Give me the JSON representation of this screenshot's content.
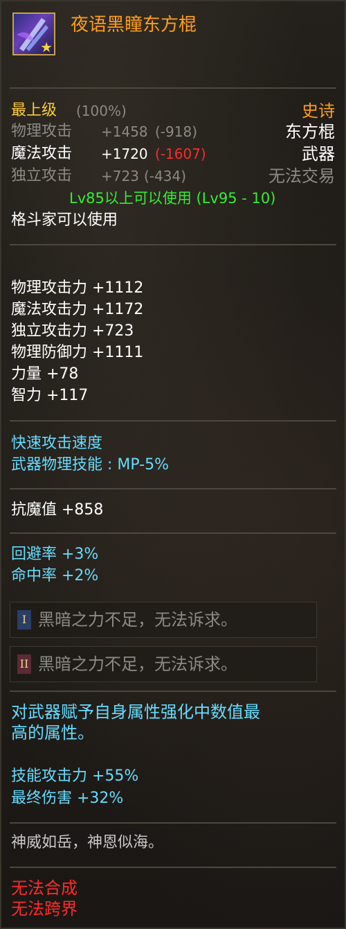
{
  "item": {
    "name": "夜语黑瞳东方棍",
    "icon": "weapon-rune-icon"
  },
  "header": {
    "grade": "最上级",
    "grade_pct": "(100%)",
    "rarity": "史诗",
    "weapon_type": "东方棍",
    "category": "武器",
    "trade": "无法交易",
    "phys_attack": "物理攻击",
    "phys_attack_val": "+1458",
    "phys_attack_diff": "(-918)",
    "mag_attack": "魔法攻击",
    "mag_attack_val": "+1720",
    "mag_attack_diff": "(-1607)",
    "ind_attack": "独立攻击",
    "ind_attack_val": "+723",
    "ind_attack_diff": "(-434)",
    "level_req": "Lv85以上可以使用 (Lv95 - 10)",
    "class_req": "格斗家可以使用"
  },
  "stats": [
    "物理攻击力 +1112",
    "魔法攻击力 +1172",
    "独立攻击力 +723",
    "物理防御力 +1111",
    "力量 +78",
    "智力 +117"
  ],
  "skills": [
    "快速攻击速度",
    "武器物理技能 : MP-5%"
  ],
  "resist": "抗魔值 +858",
  "rates": [
    "回避率 +3%",
    "命中率 +2%"
  ],
  "runes": [
    {
      "badge": "I",
      "text": "黑暗之力不足，无法诉求。"
    },
    {
      "badge": "II",
      "text": "黑暗之力不足，无法诉求。"
    }
  ],
  "effect_desc": [
    "对武器赋予自身属性强化中数值最",
    "高的属性。"
  ],
  "effects": [
    "技能攻击力 +55%",
    "最终伤害 +32%"
  ],
  "flavor": "神威如岳，神恩似海。",
  "restrictions": [
    "无法合成",
    "无法跨界"
  ]
}
